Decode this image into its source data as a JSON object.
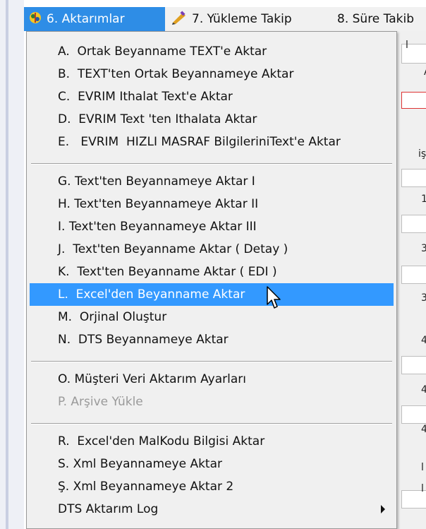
{
  "menubar": {
    "items": [
      {
        "label": "6. Aktarımlar",
        "icon": "transfer-icon"
      },
      {
        "label": "7. Yükleme Takip",
        "icon": "pen-icon"
      },
      {
        "label": "8. Süre Takib"
      }
    ]
  },
  "menu": {
    "group1": [
      "A.  Ortak Beyanname TEXT'e Aktar",
      "B.  TEXT'ten Ortak Beyannameye Aktar",
      "C.  EVRIM Ithalat Text'e Aktar",
      "D.  EVRIM Text 'ten Ithalata Aktar",
      "E.   EVRIM  HIZLI MASRAF BilgileriniText'e Aktar"
    ],
    "group2": [
      "G. Text'ten Beyannameye Aktar I",
      "H. Text'ten Beyannameye Aktar II",
      "I. Text'ten Beyannameye Aktar III",
      "J.  Text'ten Beyanname Aktar ( Detay )",
      "K.  Text'ten Beyanname Aktar ( EDI )",
      "L.  Excel'den Beyanname Aktar",
      "M.  Orjinal Oluştur",
      "N.  DTS Beyannameye Aktar"
    ],
    "group3": [
      "O. Müşteri Veri Aktarım Ayarları",
      "P. Arşive Yükle"
    ],
    "group4": [
      "R.  Excel'den MalKodu Bilgisi Aktar",
      "S. Xml Beyannameye Aktar",
      "Ş. Xml Beyannameye Aktar 2",
      "DTS Aktarım Log"
    ],
    "highlighted": "L.  Excel'den Beyanname Aktar",
    "disabled": "P. Arşive Yükle"
  },
  "background_glyphs": [
    "l",
    "A",
    "iş",
    "1",
    "3",
    "3",
    "4",
    "4",
    "4",
    "l",
    "l"
  ],
  "colors": {
    "highlight": "#3399ff",
    "menubar_active": "#2e8de6",
    "menu_bg": "#f0f0f0"
  }
}
